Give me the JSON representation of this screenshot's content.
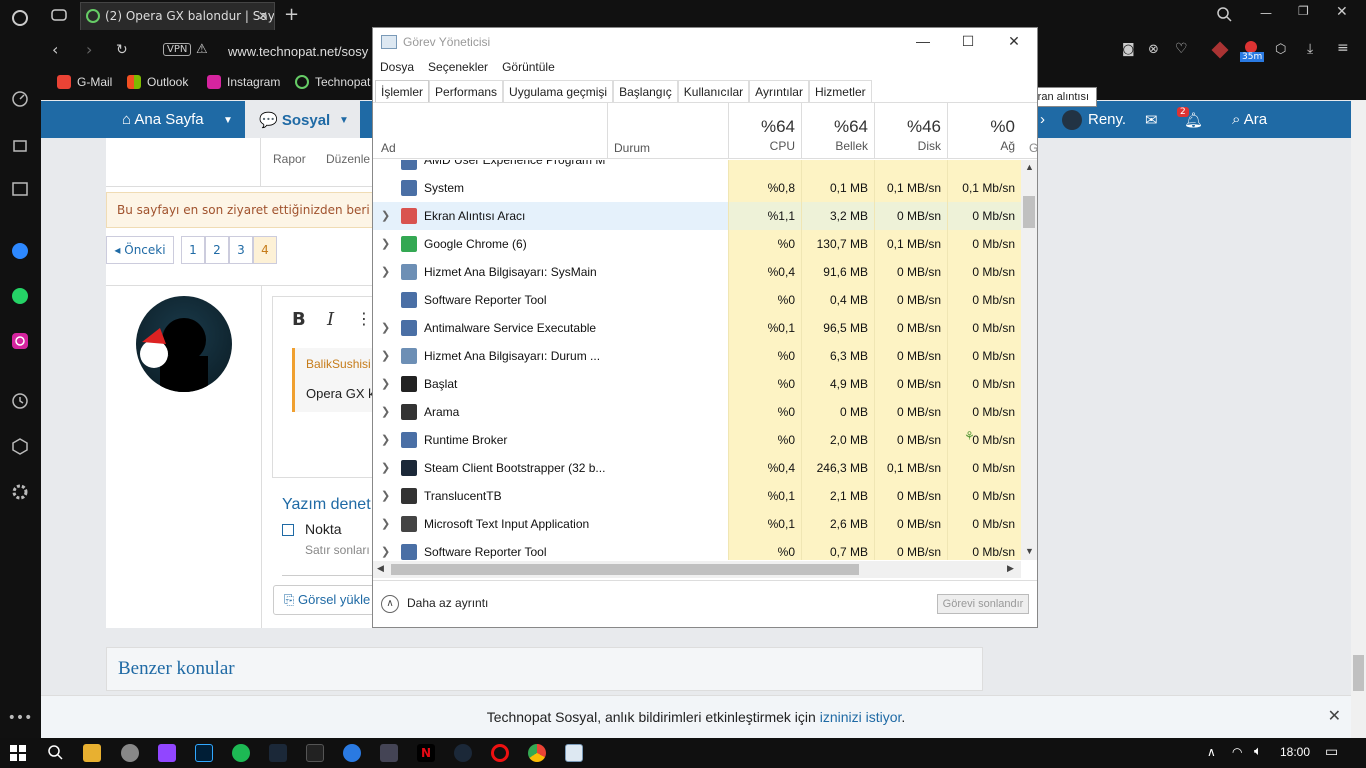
{
  "browser": {
    "tab_title": "(2) Opera GX balondur | Say",
    "url": "www.technopat.net/sosy",
    "vpn_label": "VPN",
    "badge_35m": "35m",
    "bookmarks": [
      "G-Mail",
      "Outlook",
      "Instagram",
      "Technopat"
    ]
  },
  "site": {
    "nav": [
      "Ana Sayfa",
      "Sosyal",
      "Reny.",
      "Ara"
    ],
    "notif_count": "2",
    "post_links": [
      "Rapor",
      "Düzenle"
    ],
    "notice": "Bu sayfayı en son ziyaret ettiğinizden beri go",
    "pagination": [
      "◂ Önceki",
      "1",
      "2",
      "3",
      "4"
    ],
    "editor_quote_user": "BalikSushisi",
    "editor_text": "Opera GX k",
    "yazim": "Yazım denet",
    "nokta": "Nokta",
    "satir": "Satır sonları",
    "gorsel": "Görsel yükle",
    "benzer": "Benzer konular",
    "bar_text": "Technopat Sosyal, anlık bildirimleri etkinleştirmek için",
    "bar_link": "izninizi istiyor",
    "bar_dot": "."
  },
  "tooltip": "Yeni ekran alıntısı",
  "taskmgr": {
    "title": "Görev Yöneticisi",
    "menu": [
      "Dosya",
      "Seçenekler",
      "Görüntüle"
    ],
    "tabs": [
      "İşlemler",
      "Performans",
      "Uygulama geçmişi",
      "Başlangıç",
      "Kullanıcılar",
      "Ayrıntılar",
      "Hizmetler"
    ],
    "col_ad": "Ad",
    "col_durum": "Durum",
    "columns": [
      {
        "pct": "%64",
        "label": "CPU"
      },
      {
        "pct": "%64",
        "label": "Bellek"
      },
      {
        "pct": "%46",
        "label": "Disk"
      },
      {
        "pct": "%0",
        "label": "Ağ"
      }
    ],
    "col_g": "G",
    "partial_row": "AMD User Experience Program M",
    "rows": [
      {
        "name": "System",
        "cpu": "%0,8",
        "mem": "0,1 MB",
        "disk": "0,1 MB/sn",
        "net": "0,1 Mb/sn",
        "icon": "window-icon",
        "color": "#4a6fa5",
        "chev": false
      },
      {
        "name": "Ekran Alıntısı Aracı",
        "cpu": "%1,1",
        "mem": "3,2 MB",
        "disk": "0 MB/sn",
        "net": "0 Mb/sn",
        "icon": "snipping-tool-icon",
        "color": "#d9534f",
        "chev": true
      },
      {
        "name": "Google Chrome (6)",
        "cpu": "%0",
        "mem": "130,7 MB",
        "disk": "0,1 MB/sn",
        "net": "0 Mb/sn",
        "icon": "chrome-icon",
        "color": "#34a853",
        "chev": true
      },
      {
        "name": "Hizmet Ana Bilgisayarı: SysMain",
        "cpu": "%0,4",
        "mem": "91,6 MB",
        "disk": "0 MB/sn",
        "net": "0 Mb/sn",
        "icon": "gear-icon",
        "color": "#6d8fb5",
        "chev": true
      },
      {
        "name": "Software Reporter Tool",
        "cpu": "%0",
        "mem": "0,4 MB",
        "disk": "0 MB/sn",
        "net": "0 Mb/sn",
        "icon": "window-icon",
        "color": "#4a6fa5",
        "chev": false
      },
      {
        "name": "Antimalware Service Executable",
        "cpu": "%0,1",
        "mem": "96,5 MB",
        "disk": "0 MB/sn",
        "net": "0 Mb/sn",
        "icon": "window-icon",
        "color": "#4a6fa5",
        "chev": true
      },
      {
        "name": "Hizmet Ana Bilgisayarı: Durum ...",
        "cpu": "%0",
        "mem": "6,3 MB",
        "disk": "0 MB/sn",
        "net": "0 Mb/sn",
        "icon": "gear-icon",
        "color": "#6d8fb5",
        "chev": true
      },
      {
        "name": "Başlat",
        "cpu": "%0",
        "mem": "4,9 MB",
        "disk": "0 MB/sn",
        "net": "0 Mb/sn",
        "icon": "start-icon",
        "color": "#222",
        "chev": true
      },
      {
        "name": "Arama",
        "cpu": "%0",
        "mem": "0 MB",
        "disk": "0 MB/sn",
        "net": "0 Mb/sn",
        "icon": "search-icon",
        "color": "#333",
        "chev": true
      },
      {
        "name": "Runtime Broker",
        "cpu": "%0",
        "mem": "2,0 MB",
        "disk": "0 MB/sn",
        "net": "0 Mb/sn",
        "icon": "window-icon",
        "color": "#4a6fa5",
        "chev": true
      },
      {
        "name": "Steam Client Bootstrapper (32 b...",
        "cpu": "%0,4",
        "mem": "246,3 MB",
        "disk": "0,1 MB/sn",
        "net": "0 Mb/sn",
        "icon": "steam-icon",
        "color": "#1b2838",
        "chev": true
      },
      {
        "name": "TranslucentTB",
        "cpu": "%0,1",
        "mem": "2,1 MB",
        "disk": "0 MB/sn",
        "net": "0 Mb/sn",
        "icon": "translucenttb-icon",
        "color": "#333",
        "chev": true
      },
      {
        "name": "Microsoft Text Input Application",
        "cpu": "%0,1",
        "mem": "2,6 MB",
        "disk": "0 MB/sn",
        "net": "0 Mb/sn",
        "icon": "keyboard-icon",
        "color": "#444",
        "chev": true
      },
      {
        "name": "Software Reporter Tool",
        "cpu": "%0",
        "mem": "0,7 MB",
        "disk": "0 MB/sn",
        "net": "0 Mb/sn",
        "icon": "window-icon",
        "color": "#4a6fa5",
        "chev": true
      }
    ],
    "less_detail": "Daha az ayrıntı",
    "end_task": "Görevi sonlandır"
  },
  "clock": "18:00"
}
